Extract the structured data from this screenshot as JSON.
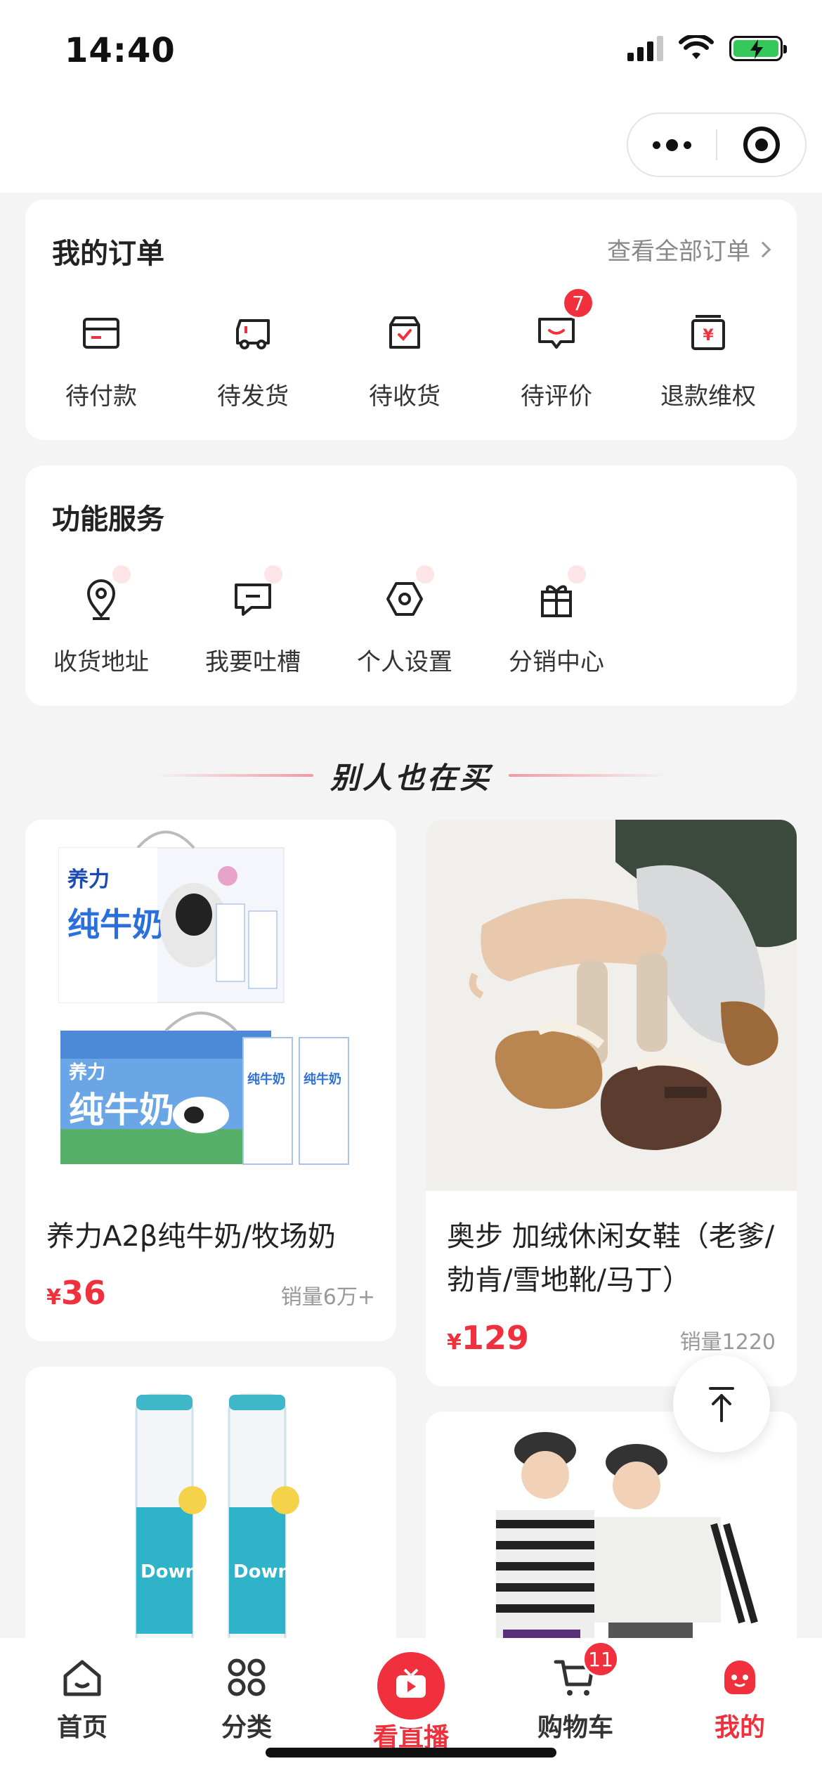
{
  "status_bar": {
    "time": "14:40"
  },
  "orders": {
    "title": "我的订单",
    "view_all": "查看全部订单",
    "items": [
      {
        "label": "待付款",
        "icon": "wallet-card-icon"
      },
      {
        "label": "待发货",
        "icon": "truck-icon"
      },
      {
        "label": "待收货",
        "icon": "box-check-icon"
      },
      {
        "label": "待评价",
        "icon": "comment-icon",
        "badge": "7"
      },
      {
        "label": "退款维权",
        "icon": "refund-yen-icon"
      }
    ]
  },
  "services": {
    "title": "功能服务",
    "items": [
      {
        "label": "收货地址",
        "icon": "location-pin-icon"
      },
      {
        "label": "我要吐槽",
        "icon": "feedback-bubble-icon"
      },
      {
        "label": "个人设置",
        "icon": "settings-hexagon-icon"
      },
      {
        "label": "分销中心",
        "icon": "gift-icon"
      }
    ]
  },
  "recommend": {
    "title": "别人也在买"
  },
  "products": [
    {
      "name": "养力A2β纯牛奶/牧场奶",
      "currency": "¥",
      "price": "36",
      "sales": "销量6万+",
      "image": "milk-boxes-image"
    },
    {
      "name": "奥步 加绒休闲女鞋（老爹/勃肯/雪地靴/马丁）",
      "currency": "¥",
      "price": "129",
      "sales": "销量1220",
      "image": "fleece-clogs-image"
    },
    {
      "name": "",
      "image": "foam-cleaner-bottles-image"
    },
    {
      "name": "",
      "image": "kids-sweatshirts-image"
    }
  ],
  "tab_bar": {
    "tabs": [
      {
        "label": "首页",
        "icon": "home-icon"
      },
      {
        "label": "分类",
        "icon": "category-grid-icon"
      },
      {
        "label": "看直播",
        "icon": "live-tv-icon"
      },
      {
        "label": "购物车",
        "icon": "cart-icon",
        "badge": "11"
      },
      {
        "label": "我的",
        "icon": "profile-face-icon"
      }
    ],
    "active": "我的"
  },
  "colors": {
    "accent": "#f0303c",
    "page_bg": "#f4f4f4",
    "card_bg": "#ffffff"
  }
}
